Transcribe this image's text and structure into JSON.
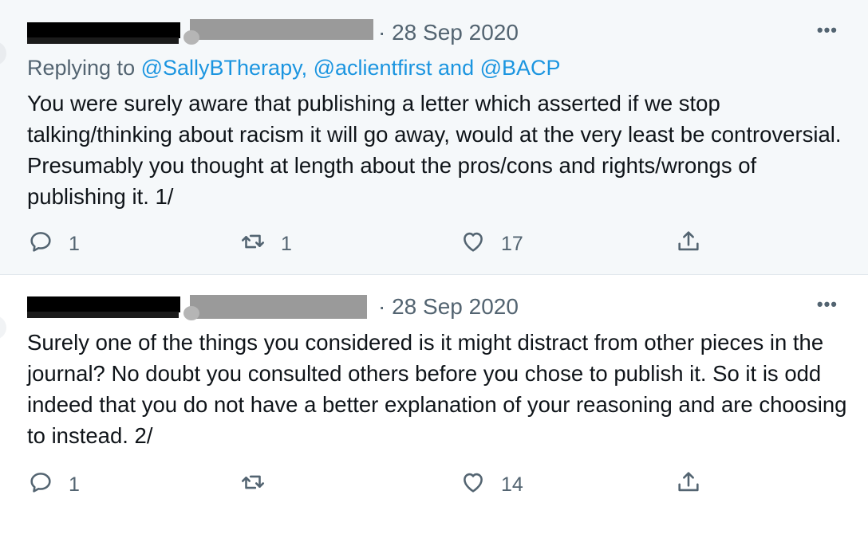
{
  "tweets": [
    {
      "date": "· 28 Sep 2020",
      "more": "•••",
      "replying_prefix": "Replying to ",
      "replying_mentions": "@SallyBTherapy, @aclientfirst and @BACP",
      "text": "You were surely aware that publishing a letter which asserted if we stop talking/thinking about racism it will go away, would at the very least be controversial. Presumably you thought at length about the pros/cons and rights/wrongs of publishing it. 1/",
      "reply_count": "1",
      "retweet_count": "1",
      "like_count": "17"
    },
    {
      "date": "· 28 Sep 2020",
      "more": "•••",
      "text": "Surely one of the things you considered is it might distract from other pieces in the journal? No doubt you consulted others before you chose to publish it. So it is odd indeed that you do not have a better explanation of your reasoning and are choosing to instead. 2/",
      "reply_count": "1",
      "retweet_count": "",
      "like_count": "14"
    }
  ],
  "colors": {
    "text": "#0f1419",
    "secondary": "#536471",
    "link": "#1b95e0",
    "highlight_bg": "#f5f8fa"
  },
  "icons": [
    "reply-icon",
    "retweet-icon",
    "like-icon",
    "share-icon",
    "more-icon"
  ]
}
